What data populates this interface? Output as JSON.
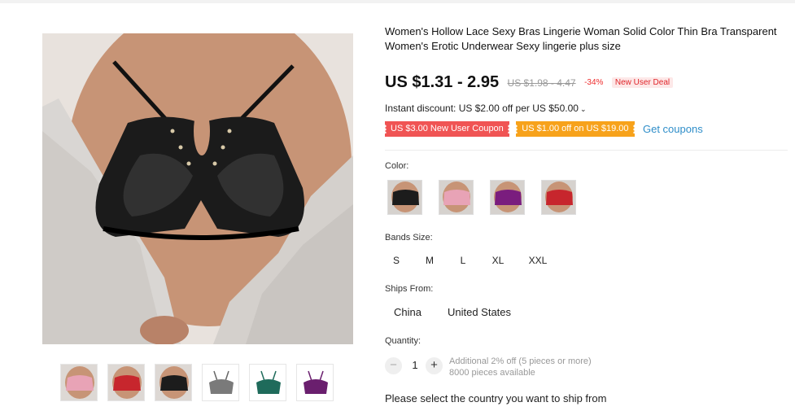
{
  "product": {
    "title": "Women's Hollow Lace Sexy Bras Lingerie Woman Solid Color Thin Bra Transparent Women's Erotic Underwear Sexy lingerie plus size"
  },
  "gallery": {
    "main_image_icon": "lace-bra-photo",
    "thumbnails": [
      {
        "color": "pink",
        "hex": "#e8a3b6"
      },
      {
        "color": "red",
        "hex": "#c7262d"
      },
      {
        "color": "black",
        "hex": "#1c1c1c"
      },
      {
        "color": "grey",
        "hex": "#7a7a7a"
      },
      {
        "color": "green",
        "hex": "#1f6b5b"
      },
      {
        "color": "purple",
        "hex": "#6a1f6e"
      }
    ]
  },
  "price": {
    "current": "US $1.31 - 2.95",
    "original": "US $1.98 - 4.47",
    "discount": "-34%",
    "badge": "New User Deal"
  },
  "instant_discount": {
    "text": "Instant discount: US $2.00 off per US $50.00"
  },
  "coupons": {
    "items": [
      {
        "text": "US $3.00 New User Coupon",
        "color": "#f05454"
      },
      {
        "text": "US $1.00 off on US $19.00",
        "color": "#f7a21b"
      }
    ],
    "get_label": "Get coupons"
  },
  "color": {
    "label": "Color:",
    "swatches": [
      {
        "color": "black",
        "hex": "#1c1c1c"
      },
      {
        "color": "pink",
        "hex": "#e8a3b6"
      },
      {
        "color": "purple",
        "hex": "#7a1d7e"
      },
      {
        "color": "red",
        "hex": "#c7262d"
      }
    ]
  },
  "sizes": {
    "label": "Bands Size:",
    "options": [
      "S",
      "M",
      "L",
      "XL",
      "XXL"
    ]
  },
  "ships_from": {
    "label": "Ships From:",
    "options": [
      "China",
      "United States"
    ]
  },
  "quantity": {
    "label": "Quantity:",
    "value": "1",
    "minus": "−",
    "plus": "+",
    "bulk_note": "Additional 2% off (5 pieces or more)",
    "available": "8000 pieces available"
  },
  "shipping_notice": "Please select the country you want to ship from"
}
